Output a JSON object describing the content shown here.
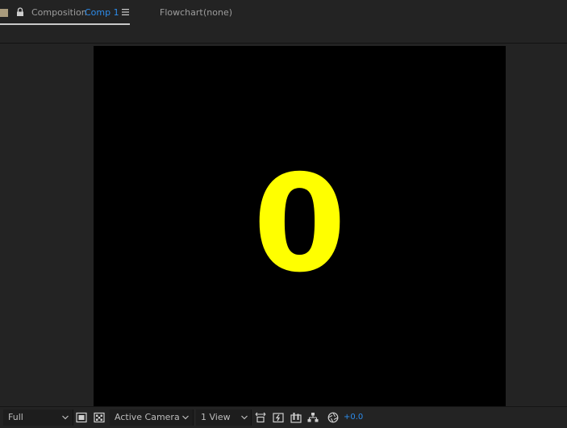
{
  "tabs": {
    "composition": {
      "label": "Composition",
      "name": "Comp 1"
    },
    "flowchart": {
      "label": "Flowchart",
      "value": "(none)"
    }
  },
  "viewer": {
    "text_layer": "0",
    "text_color": "#ffff00",
    "background": "#000000"
  },
  "footer": {
    "resolution": "Full",
    "camera": "Active Camera",
    "view_layout": "1 View",
    "exposure": "+0.0"
  },
  "colors": {
    "accent": "#2d8ceb",
    "panel": "#232323",
    "label_swatch": "#a99b7d"
  },
  "icons": [
    "lock-icon",
    "panel-menu-icon",
    "chevron-down-icon",
    "region-of-interest-icon",
    "transparency-grid-icon",
    "reset-exposure-icon",
    "fast-preview-icon",
    "toggle-views-icon",
    "flowchart-icon",
    "exposure-icon"
  ]
}
